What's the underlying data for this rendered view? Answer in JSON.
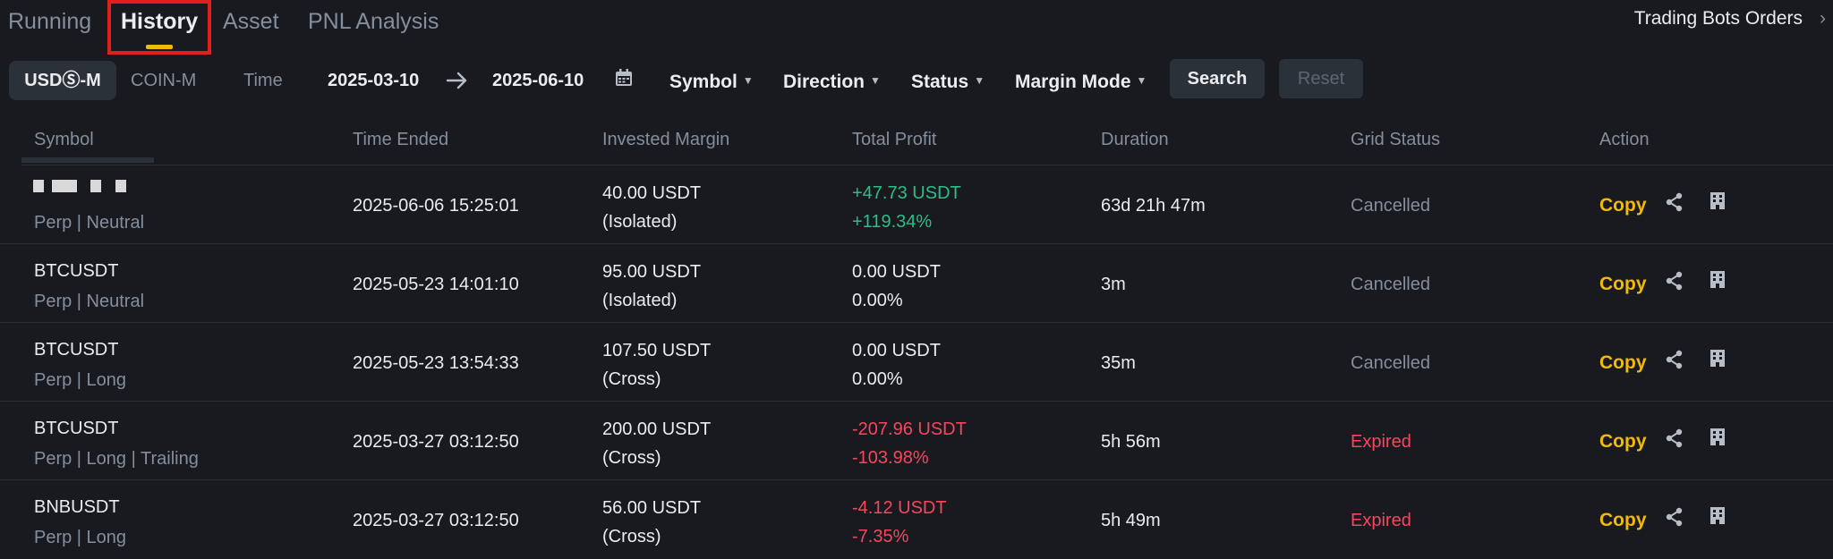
{
  "tabs": [
    {
      "label": "Running"
    },
    {
      "label": "History"
    },
    {
      "label": "Asset"
    },
    {
      "label": "PNL Analysis"
    }
  ],
  "trading_bots_orders": "Trading Bots Orders",
  "filters": {
    "segments": [
      "USDⓈ-M",
      "COIN-M"
    ],
    "time_label": "Time",
    "date_from": "2025-03-10",
    "date_to": "2025-06-10",
    "dropdowns": [
      "Symbol",
      "Direction",
      "Status",
      "Margin Mode"
    ],
    "search_label": "Search",
    "reset_label": "Reset"
  },
  "table": {
    "headers": [
      "Symbol",
      "Time Ended",
      "Invested Margin",
      "Total Profit",
      "Duration",
      "Grid Status",
      "Action"
    ],
    "rows": [
      {
        "symbol": "",
        "sub": "Perp | Neutral",
        "time_ended": "2025-06-06 15:25:01",
        "margin": "40.00 USDT",
        "margin_mode": "(Isolated)",
        "profit": "+47.73 USDT",
        "profit_pct": "+119.34%",
        "profit_color": "#2ebd85",
        "duration": "63d 21h 47m",
        "status": "Cancelled",
        "status_color": "#848e9c",
        "action": "Copy"
      },
      {
        "symbol": "BTCUSDT",
        "sub": "Perp | Neutral",
        "time_ended": "2025-05-23 14:01:10",
        "margin": "95.00 USDT",
        "margin_mode": "(Isolated)",
        "profit": "0.00 USDT",
        "profit_pct": "0.00%",
        "profit_color": "#eaecef",
        "duration": "3m",
        "status": "Cancelled",
        "status_color": "#848e9c",
        "action": "Copy"
      },
      {
        "symbol": "BTCUSDT",
        "sub": "Perp | Long",
        "time_ended": "2025-05-23 13:54:33",
        "margin": "107.50 USDT",
        "margin_mode": "(Cross)",
        "profit": "0.00 USDT",
        "profit_pct": "0.00%",
        "profit_color": "#eaecef",
        "duration": "35m",
        "status": "Cancelled",
        "status_color": "#848e9c",
        "action": "Copy"
      },
      {
        "symbol": "BTCUSDT",
        "sub": "Perp | Long | Trailing",
        "time_ended": "2025-03-27 03:12:50",
        "margin": "200.00 USDT",
        "margin_mode": "(Cross)",
        "profit": "-207.96 USDT",
        "profit_pct": "-103.98%",
        "profit_color": "#f6465d",
        "duration": "5h 56m",
        "status": "Expired",
        "status_color": "#f6465d",
        "action": "Copy"
      },
      {
        "symbol": "BNBUSDT",
        "sub": "Perp | Long",
        "time_ended": "2025-03-27 03:12:50",
        "margin": "56.00 USDT",
        "margin_mode": "(Cross)",
        "profit": "-4.12 USDT",
        "profit_pct": "-7.35%",
        "profit_color": "#f6465d",
        "duration": "5h 49m",
        "status": "Expired",
        "status_color": "#f6465d",
        "action": "Copy"
      }
    ]
  },
  "colors": {
    "background": "#181a20",
    "accent": "#f0b90b",
    "positive": "#2ebd85",
    "negative": "#f6465d",
    "highlight_box": "#e0201c"
  }
}
